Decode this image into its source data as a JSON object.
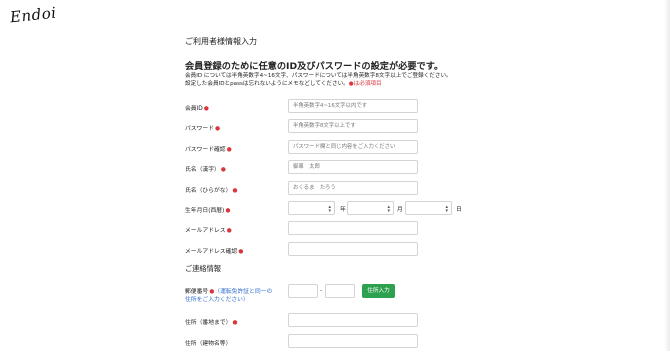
{
  "logo": "Endoi",
  "sections": {
    "user_info": "ご利用者様情報入力",
    "contact": "ご連絡情報"
  },
  "intro": {
    "title": "会員登録のために任意のID及びパスワードの設定が必要です。",
    "line1": "会員ID については半角英数字4~16文字、パスワードについては半角英数字8文字以上でご登録ください。",
    "line2": "設定した会員IDとpassは忘れないようにメモなどしてください。",
    "required_note": "●は必須項目"
  },
  "fields": {
    "member_id": {
      "label": "会員ID",
      "placeholder": "半角英数字4~16文字以内です"
    },
    "password": {
      "label": "パスワード",
      "placeholder": "半角英数字8文字以上です"
    },
    "password_confirm": {
      "label": "パスワード確認",
      "placeholder": "パスワード欄と同じ内容をご入力ください"
    },
    "name_kanji": {
      "label": "氏名（漢字）",
      "placeholder": "御車　太郎"
    },
    "name_kana": {
      "label": "氏名（ひらがな）",
      "placeholder": "おくるま　たろう"
    },
    "birthdate": {
      "label": "生年月日(西暦)",
      "year_unit": "年",
      "month_unit": "月",
      "day_unit": "日"
    },
    "email": {
      "label": "メールアドレス",
      "placeholder": ""
    },
    "email_confirm": {
      "label": "メールアドレス確認",
      "placeholder": ""
    },
    "zip": {
      "label": "郵便番号",
      "note": "（運転免許証と同一の",
      "note2": "住所をご入力ください）",
      "dash": "-",
      "button": "住所入力"
    },
    "address1": {
      "label": "住所（番地まで）",
      "placeholder": ""
    },
    "address2": {
      "label": "住所（建物名等）",
      "placeholder": ""
    }
  },
  "required_mark": "●",
  "colors": {
    "required": "#d9363e",
    "button_green": "#2ea14f",
    "link_blue": "#2f6fd1"
  }
}
